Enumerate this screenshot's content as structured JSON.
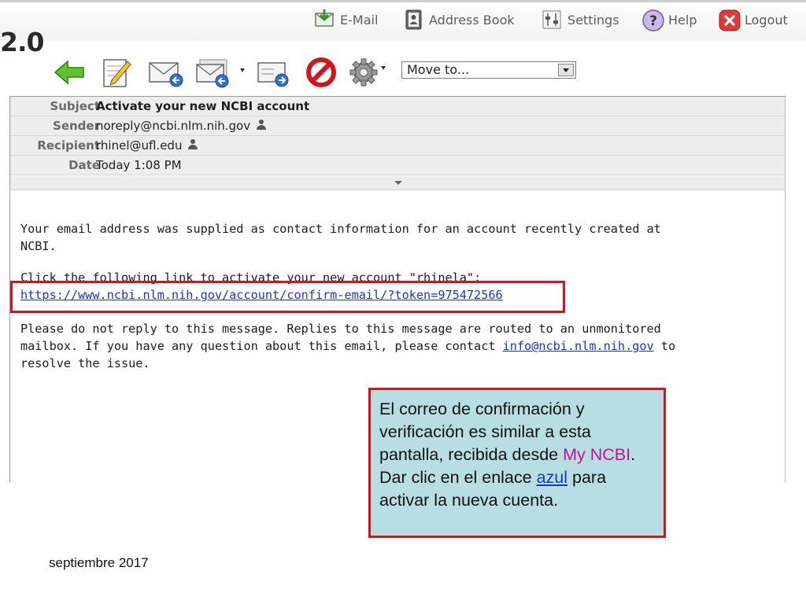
{
  "nav": {
    "email": "E-Mail",
    "address_book": "Address Book",
    "settings": "Settings",
    "help": "Help",
    "logout": "Logout"
  },
  "brand_version": "2.0",
  "toolbar": {
    "move_to": "Move to...",
    "icons": [
      "back-arrow-icon",
      "compose-icon",
      "reply-icon",
      "reply-all-icon",
      "forward-icon",
      "delete-icon",
      "gear-icon"
    ]
  },
  "message": {
    "headers": [
      {
        "label": "Subject",
        "value": "Activate your new NCBI account"
      },
      {
        "label": "Sender",
        "value": "noreply@ncbi.nlm.nih.gov"
      },
      {
        "label": "Recipient",
        "value": "rhinel@ufl.edu"
      },
      {
        "label": "Date",
        "value": "Today 1:08 PM"
      }
    ],
    "body": {
      "line1": "Your email address was supplied as contact information for an account recently created at",
      "line2": "NCBI.",
      "line3": "Click the following link to activate your new account \"rhinela\":",
      "activation_link": "https://www.ncbi.nlm.nih.gov/account/confirm-email/?token=975472566",
      "line4": "Please do not reply to this message. Replies to this message are routed to an unmonitored",
      "line5_pre": "mailbox. If you have any question about this email, please contact ",
      "contact_email": "info@ncbi.nlm.nih.gov",
      "line5_post": " to",
      "line6": "resolve the issue."
    }
  },
  "callout": {
    "part1": "El correo de confirmación y verificación es similar a esta pantalla, recibida desde ",
    "my_ncbi": "My NCBI",
    "part2": ".  Dar clic en el enlace ",
    "azul": "azul",
    "part3": " para activar la nueva cuenta."
  },
  "footer_date": "septiembre 2017",
  "colors": {
    "highlight_border": "#e0101a",
    "callout_bg": "#b7dee2",
    "link": "#1a35c8",
    "accent_magenta": "#c4128e"
  }
}
